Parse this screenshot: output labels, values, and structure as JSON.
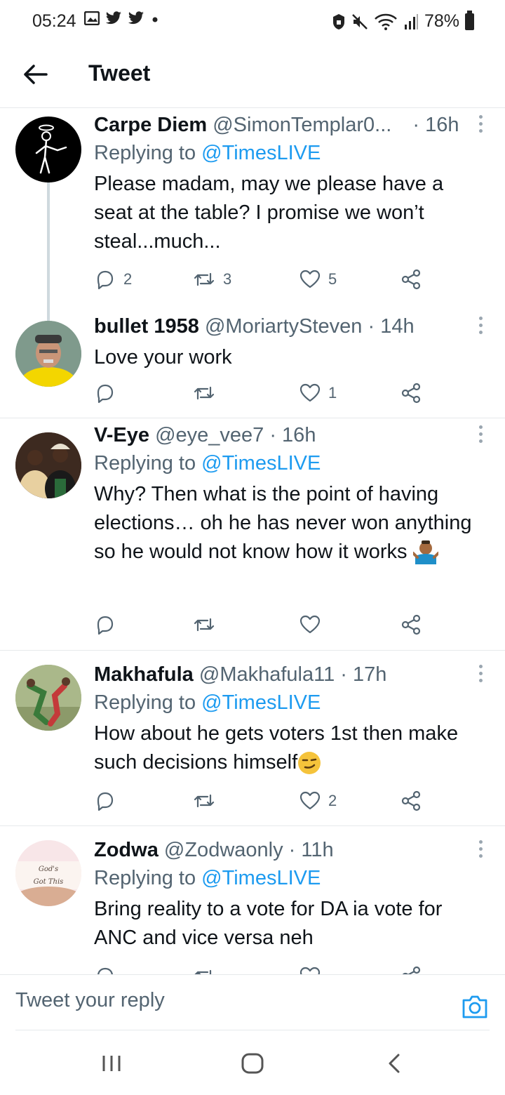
{
  "status_bar": {
    "time": "05:24",
    "battery": "78%",
    "left_icons": [
      "gallery-icon",
      "twitter-bird-icon",
      "twitter-bird-icon",
      "dot-icon"
    ],
    "right_icons": [
      "secure-folder-icon",
      "mute-icon",
      "wifi-icon",
      "signal-icon",
      "battery-icon"
    ]
  },
  "header": {
    "title": "Tweet"
  },
  "tweets": [
    {
      "name": "Carpe Diem",
      "handle": "@SimonTemplar0...",
      "time": "· 16h",
      "replying_label": "Replying to",
      "replying_handle": "@TimesLIVE",
      "text": "Please madam, may we please have a seat at the table? I promise we won’t steal...much...",
      "replies": "2",
      "retweets": "3",
      "likes": "5"
    },
    {
      "name": "bullet 1958",
      "handle": "@MoriartySteven",
      "time": "· 14h",
      "text": "Love your work",
      "replies": "",
      "retweets": "",
      "likes": "1"
    },
    {
      "name": "V-Eye",
      "handle": "@eye_vee7",
      "time": "· 16h",
      "replying_label": "Replying to",
      "replying_handle": "@TimesLIVE",
      "text": "Why? Then what is the point of having elections… oh he has never won anything so he would not know how it works",
      "emoji": "shrug-emoji",
      "replies": "",
      "retweets": "",
      "likes": ""
    },
    {
      "name": "Makhafula",
      "handle": "@Makhafula11",
      "time": "· 17h",
      "replying_label": "Replying to",
      "replying_handle": "@TimesLIVE",
      "text": "How about he gets voters 1st then make such decisions himself",
      "emoji": "smirk-emoji",
      "replies": "",
      "retweets": "",
      "likes": "2"
    },
    {
      "name": "Zodwa",
      "handle": "@Zodwaonly",
      "time": "· 11h",
      "replying_label": "Replying to",
      "replying_handle": "@TimesLIVE",
      "text": "Bring reality to a vote for DA ia vote for ANC and vice versa neh",
      "avatar_text": [
        "God's",
        "Got This"
      ]
    }
  ],
  "reply_bar": {
    "placeholder": "Tweet your reply"
  },
  "colors": {
    "accent": "#1d9bf0",
    "text": "#0f1419",
    "secondary": "#536471",
    "divider": "#e6e9eb"
  }
}
